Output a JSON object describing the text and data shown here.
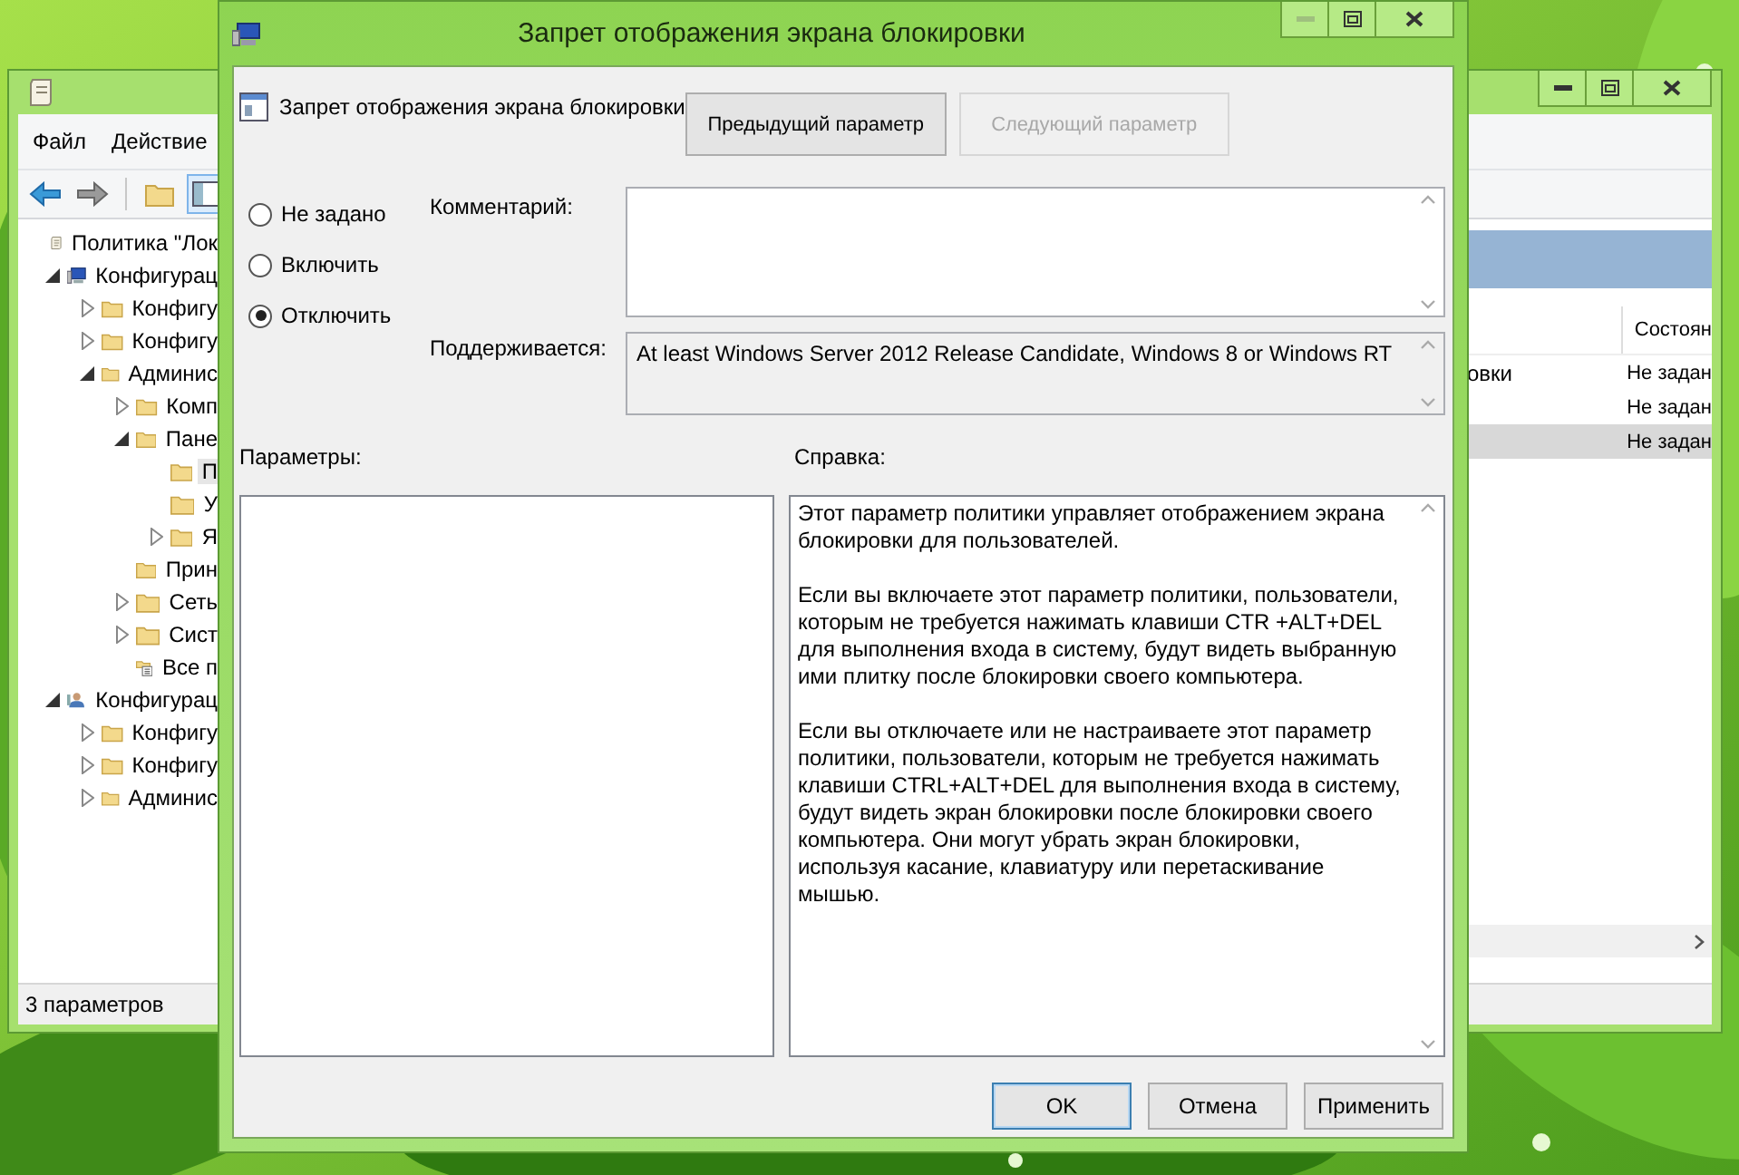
{
  "back_window": {
    "menu": [
      "Файл",
      "Действие"
    ],
    "tree": [
      {
        "label": "Политика \"Лок",
        "kind": "policy",
        "selected": false,
        "children": [
          {
            "label": "Конфигурац",
            "kind": "computer",
            "expanded": true,
            "selected": false,
            "children": [
              {
                "label": "Конфигу",
                "kind": "folder",
                "expanded": false,
                "selected": false
              },
              {
                "label": "Конфигу",
                "kind": "folder",
                "expanded": false,
                "selected": false
              },
              {
                "label": "Админис",
                "kind": "folder",
                "expanded": true,
                "selected": false,
                "children": [
                  {
                    "label": "Комп",
                    "kind": "folder",
                    "expanded": false,
                    "selected": false
                  },
                  {
                    "label": "Пане",
                    "kind": "folder",
                    "expanded": true,
                    "selected": false,
                    "children": [
                      {
                        "label": "П",
                        "kind": "folder",
                        "selected": true
                      },
                      {
                        "label": "У",
                        "kind": "folder",
                        "selected": false
                      },
                      {
                        "label": "Я",
                        "kind": "folder",
                        "expanded": false,
                        "selected": false
                      }
                    ]
                  },
                  {
                    "label": "Прин",
                    "kind": "folder",
                    "selected": false
                  },
                  {
                    "label": "Сеть",
                    "kind": "folder",
                    "expanded": false,
                    "selected": false
                  },
                  {
                    "label": "Сист",
                    "kind": "folder",
                    "expanded": false,
                    "selected": false
                  },
                  {
                    "label": "Все п",
                    "kind": "all",
                    "selected": false
                  }
                ]
              }
            ]
          },
          {
            "label": "Конфигурац",
            "kind": "user",
            "expanded": true,
            "selected": false,
            "children": [
              {
                "label": "Конфигу",
                "kind": "folder",
                "expanded": false,
                "selected": false
              },
              {
                "label": "Конфигу",
                "kind": "folder",
                "expanded": false,
                "selected": false
              },
              {
                "label": "Админис",
                "kind": "folder",
                "expanded": false,
                "selected": false
              }
            ]
          }
        ]
      }
    ],
    "list": {
      "column": "Состоян",
      "rows": [
        {
          "name": "овки",
          "state": "Не задан",
          "selected": false
        },
        {
          "state": "Не задан",
          "selected": false
        },
        {
          "state": "Не задан",
          "selected": true
        }
      ]
    },
    "status_bar": "3 параметров"
  },
  "dialog": {
    "title": "Запрет отображения экрана блокировки",
    "setting_title": "Запрет отображения экрана блокировки",
    "nav_buttons": [
      {
        "label": "Предыдущий параметр",
        "disabled": false
      },
      {
        "label": "Следующий параметр",
        "disabled": true
      }
    ],
    "options": [
      {
        "label": "Не задано",
        "selected": false
      },
      {
        "label": "Включить",
        "selected": false
      },
      {
        "label": "Отключить",
        "selected": true
      }
    ],
    "comment_label": "Комментарий:",
    "supported_label": "Поддерживается:",
    "supported": "At least Windows Server 2012 Release Candidate, Windows 8 or Windows RT",
    "options_label": "Параметры:",
    "help_label": "Справка:",
    "help": [
      "Этот параметр политики управляет отображением экрана блокировки для пользователей.",
      "Если вы включаете этот параметр политики, пользователи, которым не требуется нажимать клавиши CTR +ALT+DEL для выполнения входа в систему, будут видеть выбранную ими плитку после блокировки своего компьютера.",
      "Если вы отключаете или не настраиваете этот параметр политики, пользователи, которым не требуется нажимать клавиши CTRL+ALT+DEL для выполнения входа в систему, будут видеть экран блокировки после блокировки своего компьютера. Они могут убрать экран блокировки, используя касание, клавиатуру или перетаскивание мышью."
    ],
    "buttons": [
      {
        "label": "OK",
        "default": true
      },
      {
        "label": "Отмена",
        "default": false
      },
      {
        "label": "Применить",
        "default": false
      }
    ]
  }
}
